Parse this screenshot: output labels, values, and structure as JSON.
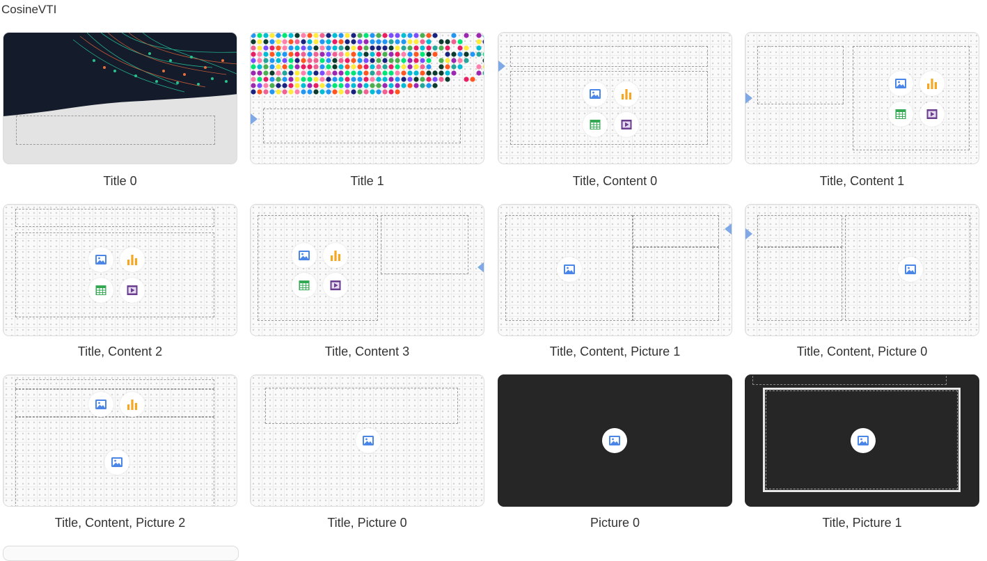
{
  "header": {
    "title": "CosineVTI"
  },
  "layouts": [
    {
      "label": "Title 0"
    },
    {
      "label": "Title 1"
    },
    {
      "label": "Title, Content 0"
    },
    {
      "label": "Title, Content 1"
    },
    {
      "label": "Title, Content 2"
    },
    {
      "label": "Title, Content 3"
    },
    {
      "label": "Title, Content, Picture 1"
    },
    {
      "label": "Title, Content, Picture 0"
    },
    {
      "label": "Title, Content, Picture 2"
    },
    {
      "label": "Title, Picture 0"
    },
    {
      "label": "Picture 0"
    },
    {
      "label": "Title, Picture 1"
    }
  ],
  "icons": {
    "picture": "picture-icon",
    "chart": "bar-chart-icon",
    "table": "table-icon",
    "video": "video-icon"
  },
  "colors": {
    "picture_icon": "#4a86e8",
    "chart_icon": "#f5a623",
    "table_icon": "#34a853",
    "video_icon": "#6a3d8f",
    "marker": "#7fa8e6",
    "dark_slide": "#262626"
  }
}
